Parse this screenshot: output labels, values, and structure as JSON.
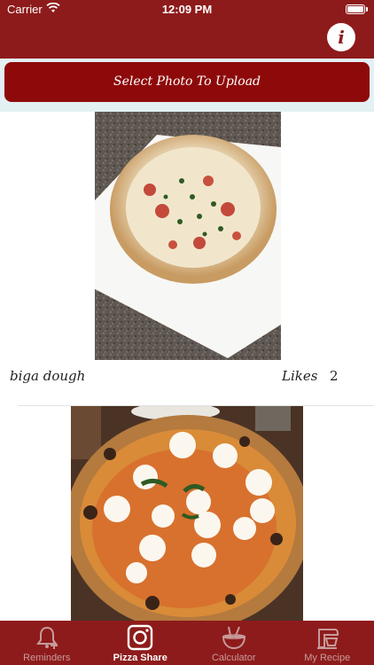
{
  "status_bar": {
    "carrier": "Carrier",
    "time": "12:09 PM"
  },
  "upload": {
    "label": "Select Photo To Upload"
  },
  "posts": [
    {
      "caption": "biga dough",
      "likes_label": "Likes",
      "likes": "2"
    }
  ],
  "tabs": [
    {
      "label": "Reminders",
      "icon": "bell-plus-icon"
    },
    {
      "label": "Pizza Share",
      "icon": "camera-icon"
    },
    {
      "label": "Calculator",
      "icon": "mixing-bowl-icon"
    },
    {
      "label": "My Recipe",
      "icon": "stand-mixer-icon"
    }
  ],
  "colors": {
    "brand": "#8e1b1b",
    "button": "#8e0a0a",
    "strip": "#e3f0f4"
  }
}
